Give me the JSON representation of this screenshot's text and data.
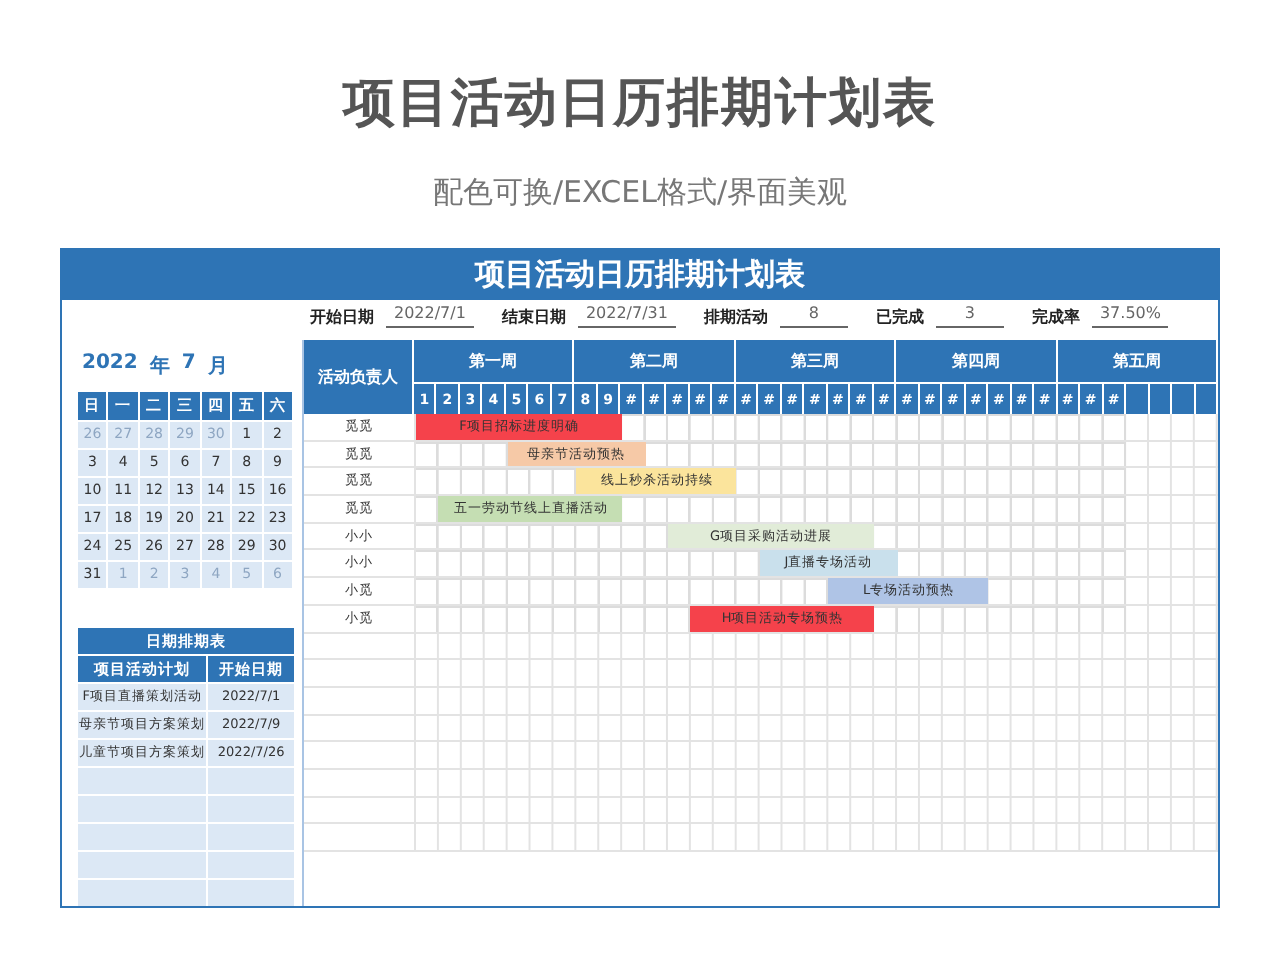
{
  "page_title": "项目活动日历排期计划表",
  "subtitle": "配色可换/EXCEL格式/界面美观",
  "sheet": {
    "title": "项目活动日历排期计划表",
    "summary": [
      {
        "label": "开始日期",
        "value": "2022/7/1"
      },
      {
        "label": "结束日期",
        "value": "2022/7/31"
      },
      {
        "label": "排期活动",
        "value": "8"
      },
      {
        "label": "已完成",
        "value": "3"
      },
      {
        "label": "完成率",
        "value": "37.50%"
      }
    ],
    "calendar": {
      "year": "2022",
      "year_unit": "年",
      "month": "7",
      "month_unit": "月",
      "weekdays": [
        "日",
        "一",
        "二",
        "三",
        "四",
        "五",
        "六"
      ],
      "days": [
        {
          "label": "26",
          "other_month": true
        },
        {
          "label": "27",
          "other_month": true
        },
        {
          "label": "28",
          "other_month": true
        },
        {
          "label": "29",
          "other_month": true
        },
        {
          "label": "30",
          "other_month": true
        },
        {
          "label": "1",
          "other_month": false
        },
        {
          "label": "2",
          "other_month": false
        },
        {
          "label": "3",
          "other_month": false
        },
        {
          "label": "4",
          "other_month": false
        },
        {
          "label": "5",
          "other_month": false
        },
        {
          "label": "6",
          "other_month": false
        },
        {
          "label": "7",
          "other_month": false
        },
        {
          "label": "8",
          "other_month": false
        },
        {
          "label": "9",
          "other_month": false
        },
        {
          "label": "10",
          "other_month": false
        },
        {
          "label": "11",
          "other_month": false
        },
        {
          "label": "12",
          "other_month": false
        },
        {
          "label": "13",
          "other_month": false
        },
        {
          "label": "14",
          "other_month": false
        },
        {
          "label": "15",
          "other_month": false
        },
        {
          "label": "16",
          "other_month": false
        },
        {
          "label": "17",
          "other_month": false
        },
        {
          "label": "18",
          "other_month": false
        },
        {
          "label": "19",
          "other_month": false
        },
        {
          "label": "20",
          "other_month": false
        },
        {
          "label": "21",
          "other_month": false
        },
        {
          "label": "22",
          "other_month": false
        },
        {
          "label": "23",
          "other_month": false
        },
        {
          "label": "24",
          "other_month": false
        },
        {
          "label": "25",
          "other_month": false
        },
        {
          "label": "26",
          "other_month": false
        },
        {
          "label": "27",
          "other_month": false
        },
        {
          "label": "28",
          "other_month": false
        },
        {
          "label": "29",
          "other_month": false
        },
        {
          "label": "30",
          "other_month": false
        },
        {
          "label": "31",
          "other_month": false
        },
        {
          "label": "1",
          "other_month": true
        },
        {
          "label": "2",
          "other_month": true
        },
        {
          "label": "3",
          "other_month": true
        },
        {
          "label": "4",
          "other_month": true
        },
        {
          "label": "5",
          "other_month": true
        },
        {
          "label": "6",
          "other_month": true
        }
      ]
    },
    "schedule": {
      "title": "日期排期表",
      "columns": [
        "项目活动计划",
        "开始日期"
      ],
      "rows": [
        [
          "F项目直播策划活动",
          "2022/7/1"
        ],
        [
          "母亲节项目方案策划",
          "2022/7/9"
        ],
        [
          "儿童节项目方案策划",
          "2022/7/26"
        ]
      ]
    },
    "gantt": {
      "owner_header": "活动负责人",
      "weeks": [
        "第一周",
        "第二周",
        "第三周",
        "第四周",
        "第五周"
      ],
      "days": [
        "1",
        "2",
        "3",
        "4",
        "5",
        "6",
        "7",
        "8",
        "9",
        "#",
        "#",
        "#",
        "#",
        "#",
        "#",
        "#",
        "#",
        "#",
        "#",
        "#",
        "#",
        "#",
        "#",
        "#",
        "#",
        "#",
        "#",
        "#",
        "#",
        "#",
        "#"
      ],
      "rows": [
        {
          "owner": "觅觅",
          "task": "F项目招标进度明确",
          "color": "#f5424b",
          "scheduled": [
            true,
            true,
            true,
            true,
            true,
            true,
            true,
            true,
            true,
            false,
            false,
            false,
            false,
            false,
            false,
            false,
            false,
            false,
            false,
            false,
            false,
            false,
            false,
            false,
            false,
            false,
            false,
            false,
            false,
            false,
            false
          ]
        },
        {
          "owner": "觅觅",
          "task": "母亲节活动预热",
          "color": "#f6c9a7",
          "scheduled": [
            false,
            false,
            false,
            false,
            true,
            true,
            true,
            true,
            true,
            true,
            false,
            false,
            false,
            false,
            false,
            false,
            false,
            false,
            false,
            false,
            false,
            false,
            false,
            false,
            false,
            false,
            false,
            false,
            false,
            false,
            false
          ]
        },
        {
          "owner": "觅觅",
          "task": "线上秒杀活动持续",
          "color": "#fbe49c",
          "scheduled": [
            false,
            false,
            false,
            false,
            false,
            false,
            false,
            true,
            true,
            true,
            true,
            true,
            true,
            true,
            false,
            false,
            false,
            false,
            false,
            false,
            false,
            false,
            false,
            false,
            false,
            false,
            false,
            false,
            false,
            false,
            false
          ]
        },
        {
          "owner": "觅觅",
          "task": "五一劳动节线上直播活动",
          "color": "#c5deb3",
          "scheduled": [
            false,
            true,
            true,
            true,
            true,
            true,
            true,
            true,
            true,
            false,
            false,
            false,
            false,
            false,
            false,
            false,
            false,
            false,
            false,
            false,
            false,
            false,
            false,
            false,
            false,
            false,
            false,
            false,
            false,
            false,
            false
          ]
        },
        {
          "owner": "小小",
          "task": "G项目采购活动进展",
          "color": "#e1ecd8",
          "scheduled": [
            false,
            false,
            false,
            false,
            false,
            false,
            false,
            false,
            false,
            false,
            false,
            true,
            true,
            true,
            true,
            true,
            true,
            true,
            true,
            true,
            false,
            false,
            false,
            false,
            false,
            false,
            false,
            false,
            false,
            false,
            false
          ]
        },
        {
          "owner": "小小",
          "task": "J直播专场活动",
          "color": "#c9e0ec",
          "scheduled": [
            false,
            false,
            false,
            false,
            false,
            false,
            false,
            false,
            false,
            false,
            false,
            false,
            false,
            false,
            false,
            true,
            true,
            true,
            true,
            true,
            true,
            false,
            false,
            false,
            false,
            false,
            false,
            false,
            false,
            false,
            false
          ]
        },
        {
          "owner": "小觅",
          "task": "L专场活动预热",
          "color": "#afc4e6",
          "scheduled": [
            false,
            false,
            false,
            false,
            false,
            false,
            false,
            false,
            false,
            false,
            false,
            false,
            false,
            false,
            false,
            false,
            false,
            false,
            true,
            true,
            true,
            true,
            true,
            true,
            true,
            false,
            false,
            false,
            false,
            false,
            false
          ]
        },
        {
          "owner": "小觅",
          "task": "H项目活动专场预热",
          "color": "#f5424b",
          "scheduled": [
            false,
            false,
            false,
            false,
            false,
            false,
            false,
            false,
            false,
            false,
            false,
            false,
            true,
            true,
            true,
            true,
            true,
            true,
            true,
            true,
            false,
            false,
            false,
            false,
            false,
            false,
            false,
            false,
            false,
            false,
            false
          ]
        }
      ]
    }
  }
}
